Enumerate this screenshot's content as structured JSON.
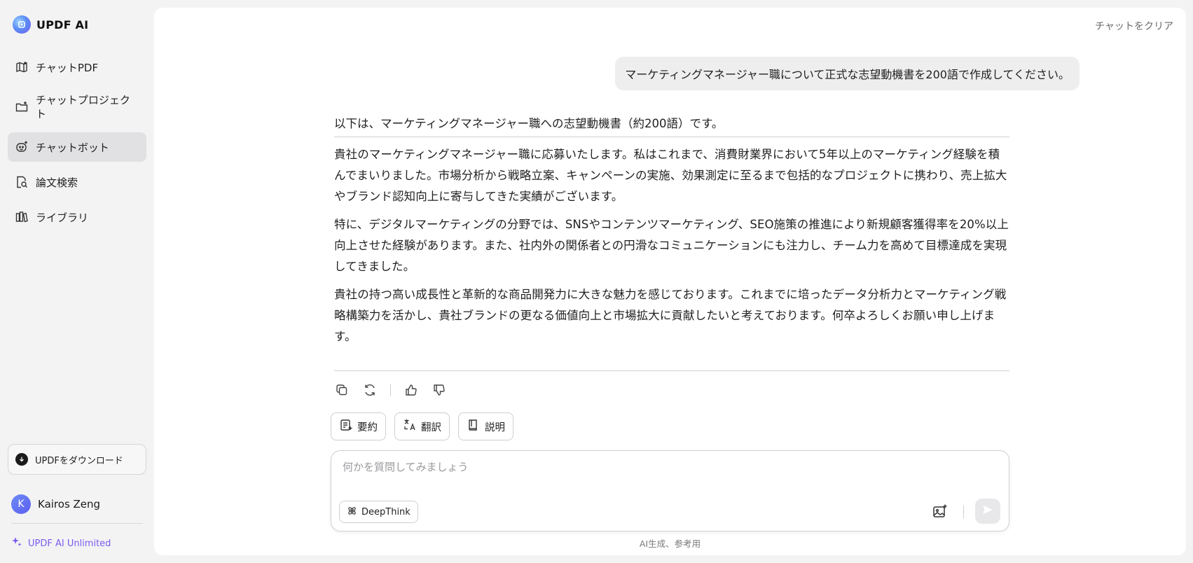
{
  "brand": {
    "name": "UPDF AI",
    "icon": "updf-logo-icon"
  },
  "nav": {
    "items": [
      {
        "label": "チャットPDF",
        "icon": "chat-pdf-icon"
      },
      {
        "label": "チャットプロジェクト",
        "icon": "folder-plus-icon"
      },
      {
        "label": "チャットボット",
        "icon": "chatbot-icon"
      },
      {
        "label": "論文検索",
        "icon": "paper-search-icon"
      },
      {
        "label": "ライブラリ",
        "icon": "library-icon"
      }
    ],
    "active_index": 2
  },
  "sidebar_footer": {
    "download_label": "UPDFをダウンロード",
    "user_initial": "K",
    "user_name": "Kairos Zeng",
    "plan_label": "UPDF AI Unlimited"
  },
  "header": {
    "clear_chat": "チャットをクリア"
  },
  "conversation": {
    "user_message": "マーケティングマネージャー職について正式な志望動機書を200語で作成してください。",
    "answer_intro": "以下は、マーケティングマネージャー職への志望動機書（約200語）です。",
    "answer_paragraphs": [
      "貴社のマーケティングマネージャー職に応募いたします。私はこれまで、消費財業界において5年以上のマーケティング経験を積んでまいりました。市場分析から戦略立案、キャンペーンの実施、効果測定に至るまで包括的なプロジェクトに携わり、売上拡大やブランド認知向上に寄与してきた実績がございます。",
      "特に、デジタルマーケティングの分野では、SNSやコンテンツマーケティング、SEO施策の推進により新規顧客獲得率を20%以上向上させた経験があります。また、社内外の関係者との円滑なコミュニケーションにも注力し、チーム力を高めて目標達成を実現してきました。",
      "貴社の持つ高い成長性と革新的な商品開発力に大きな魅力を感じております。これまでに培ったデータ分析力とマーケティング戦略構築力を活かし、貴社ブランドの更なる価値向上と市場拡大に貢献したいと考えております。何卒よろしくお願い申し上げます。"
    ]
  },
  "message_actions": [
    "copy-icon",
    "regenerate-icon",
    "thumbs-up-icon",
    "thumbs-down-icon"
  ],
  "quick_actions": [
    {
      "label": "要約",
      "icon": "summary-icon"
    },
    {
      "label": "翻訳",
      "icon": "translate-icon"
    },
    {
      "label": "説明",
      "icon": "book-icon"
    }
  ],
  "composer": {
    "placeholder": "何かを質問してみましょう",
    "value": "",
    "deepthink_label": "DeepThink"
  },
  "disclaimer": "AI生成、参考用",
  "colors": {
    "accent": "#7b5cf0",
    "active_nav_bg": "#e1e1e3",
    "panel_bg": "#ffffff",
    "page_bg": "#f3f3f4"
  }
}
